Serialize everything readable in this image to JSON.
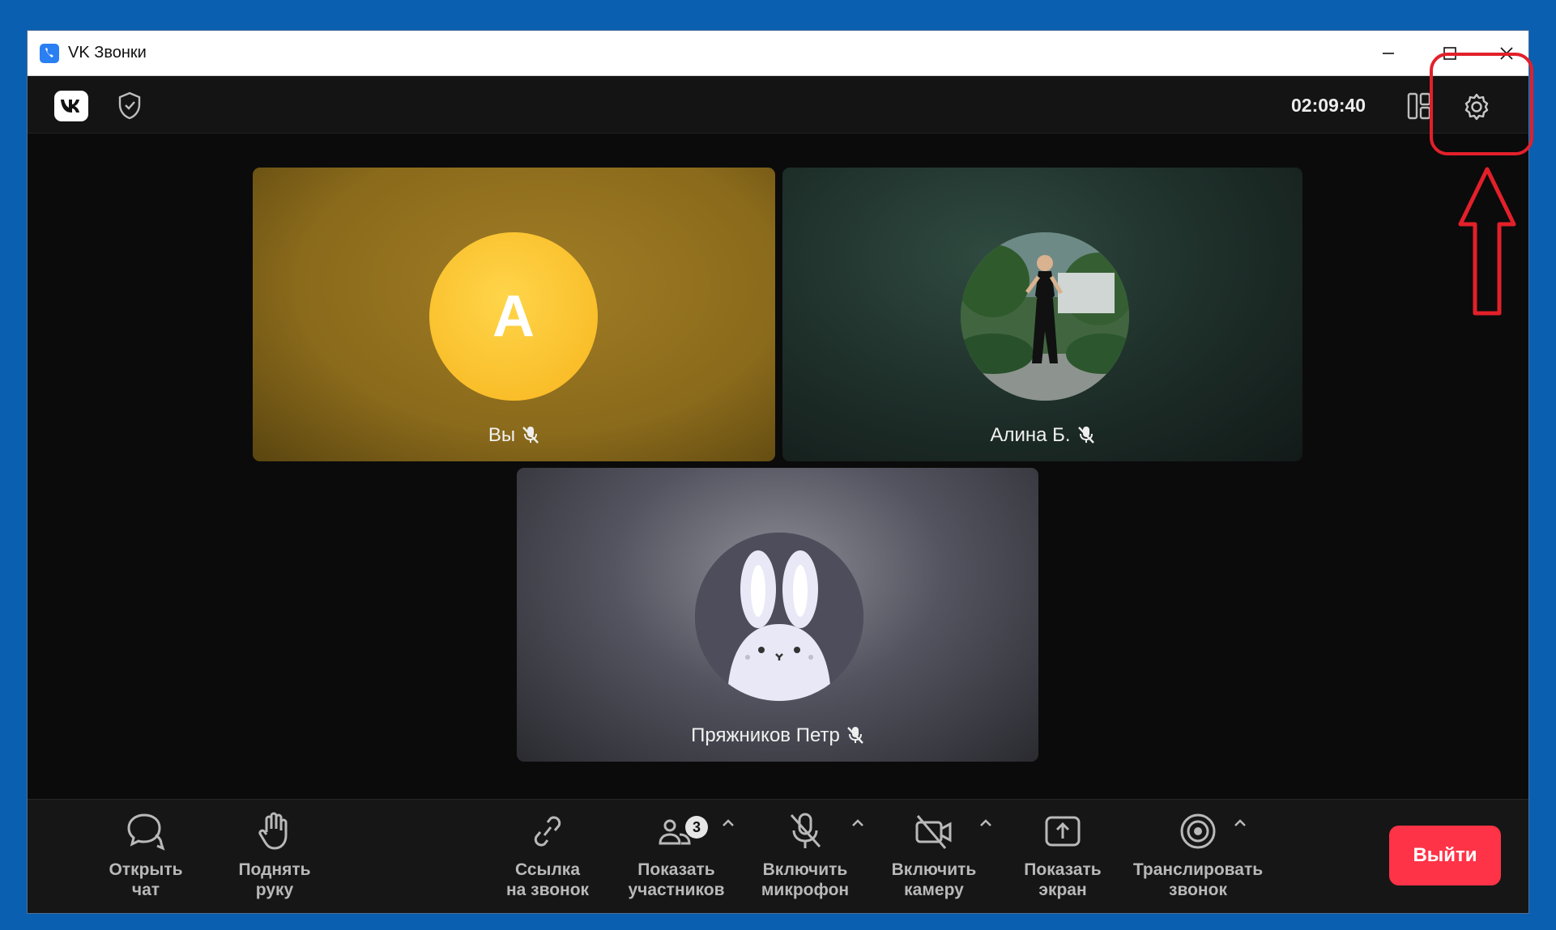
{
  "window": {
    "title": "VK Звонки"
  },
  "topbar": {
    "timer": "02:09:40",
    "logo_icon": "vk-logo",
    "security_icon": "shield-check-icon",
    "layout_icon": "layout-grid-icon",
    "settings_icon": "gear-icon"
  },
  "participants": [
    {
      "name": "Вы",
      "avatar_letter": "A",
      "avatar_color": "#f7b51d",
      "muted": true
    },
    {
      "name": "Алина Б.",
      "avatar": "photo",
      "muted": true
    },
    {
      "name": "Пряжников Петр",
      "avatar": "bunny",
      "muted": true
    }
  ],
  "toolbar": {
    "chat": {
      "line1": "Открыть",
      "line2": "чат",
      "icon": "chat-icon"
    },
    "hand": {
      "line1": "Поднять",
      "line2": "руку",
      "icon": "hand-icon"
    },
    "link": {
      "line1": "Ссылка",
      "line2": "на звонок",
      "icon": "link-icon"
    },
    "participants": {
      "line1": "Показать",
      "line2": "участников",
      "icon": "people-icon",
      "count": "3"
    },
    "mic": {
      "line1": "Включить",
      "line2": "микрофон",
      "icon": "mic-off-icon"
    },
    "camera": {
      "line1": "Включить",
      "line2": "камеру",
      "icon": "camera-off-icon"
    },
    "screen": {
      "line1": "Показать",
      "line2": "экран",
      "icon": "screen-share-icon"
    },
    "broadcast": {
      "line1": "Транслировать",
      "line2": "звонок",
      "icon": "broadcast-icon"
    },
    "exit": "Выйти"
  },
  "colors": {
    "exit_button": "#ff3347",
    "annotation": "#e3202a",
    "window_frame": "#0a5fb0"
  }
}
